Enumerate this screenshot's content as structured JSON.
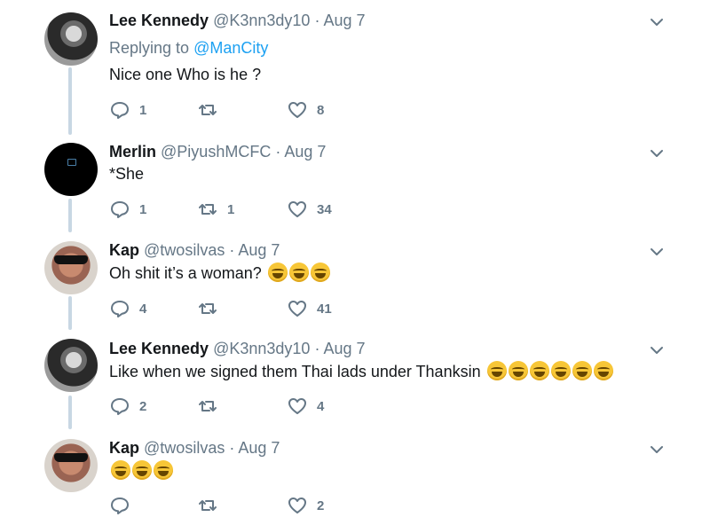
{
  "tweets": [
    {
      "name": "Lee Kennedy",
      "handle": "@K3nn3dy10",
      "date": "Aug 7",
      "replying_prefix": "Replying to",
      "replying_to": "@ManCity",
      "text": "Nice one Who is he ?",
      "emoji_count": 0,
      "replies": "1",
      "retweets": "",
      "likes": "8"
    },
    {
      "name": "Merlin",
      "handle": "@PiyushMCFC",
      "date": "Aug 7",
      "text": "*She",
      "emoji_count": 0,
      "replies": "1",
      "retweets": "1",
      "likes": "34"
    },
    {
      "name": "Kap",
      "handle": "@twosilvas",
      "date": "Aug 7",
      "text": "Oh shit it’s a woman?",
      "emoji_count": 3,
      "replies": "4",
      "retweets": "",
      "likes": "41"
    },
    {
      "name": "Lee Kennedy",
      "handle": "@K3nn3dy10",
      "date": "Aug 7",
      "text": "Like when we signed them Thai lads under Thanksin",
      "emoji_count": 6,
      "replies": "2",
      "retweets": "",
      "likes": "4"
    },
    {
      "name": "Kap",
      "handle": "@twosilvas",
      "date": "Aug 7",
      "text": "",
      "emoji_count": 3,
      "replies": "",
      "retweets": "",
      "likes": "2"
    }
  ],
  "separator": "·",
  "colors": {
    "name": "#14171a",
    "secondary": "#657786",
    "link": "#1da1f2",
    "thread_line": "#c8d7e3",
    "emoji": "face-with-tears-of-joy"
  },
  "icons": {
    "reply": "reply-icon",
    "retweet": "retweet-icon",
    "like": "heart-icon",
    "menu": "chevron-down-icon"
  }
}
